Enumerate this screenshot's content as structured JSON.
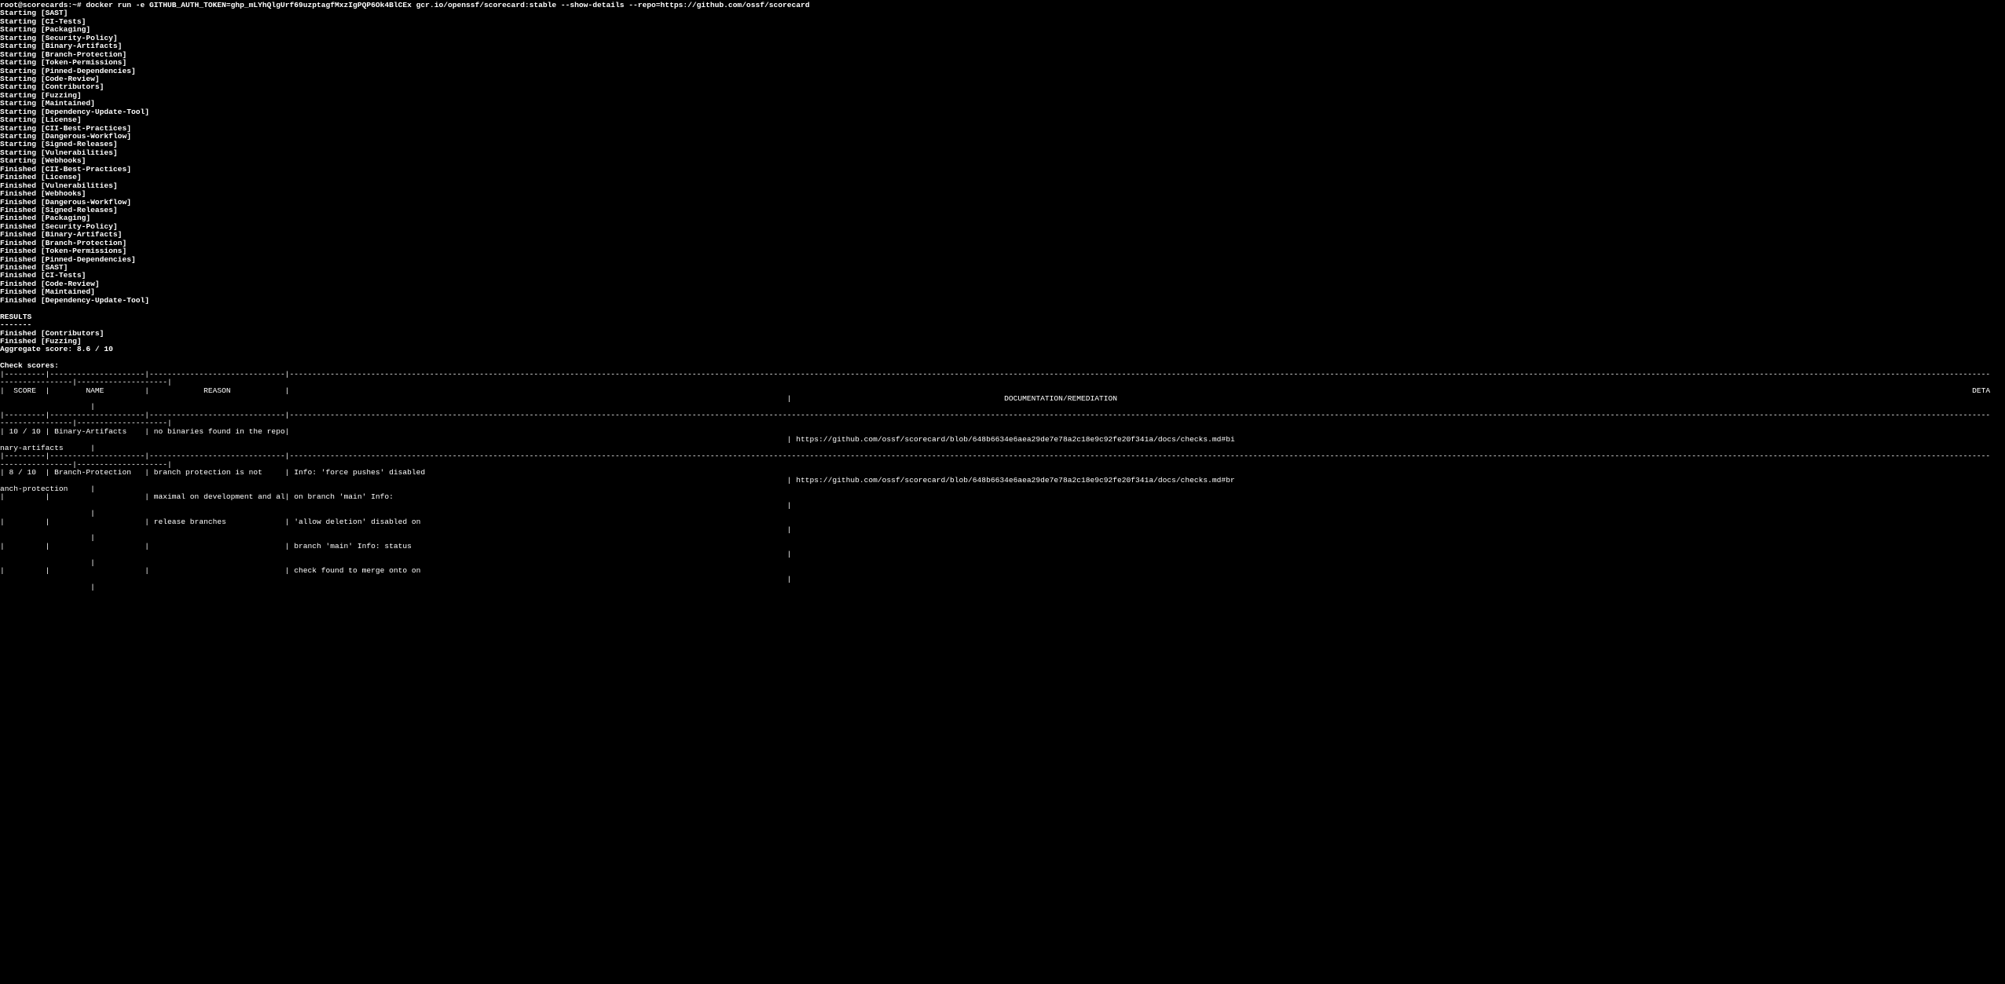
{
  "terminal": {
    "prompt": "root@scorecards:~# ",
    "command": "docker run -e GITHUB_AUTH_TOKEN=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 gcr.io/openssf/scorecard:stable --show-details --repo=https://github.com/ossf/scorecard",
    "progress_lines": [
      "Starting [SAST]",
      "Starting [CI-Tests]",
      "Starting [Packaging]",
      "Starting [Security-Policy]",
      "Starting [Binary-Artifacts]",
      "Starting [Branch-Protection]",
      "Starting [Token-Permissions]",
      "Starting [Pinned-Dependencies]",
      "Starting [Code-Review]",
      "Starting [Contributors]",
      "Starting [Fuzzing]",
      "Starting [Maintained]",
      "Starting [Dependency-Update-Tool]",
      "Starting [License]",
      "Starting [CII-Best-Practices]",
      "Starting [Dangerous-Workflow]",
      "Starting [Signed-Releases]",
      "Starting [Vulnerabilities]",
      "Starting [Webhooks]",
      "Finished [CII-Best-Practices]",
      "Finished [License]",
      "Finished [Vulnerabilities]",
      "Finished [Webhooks]",
      "Finished [Dangerous-Workflow]",
      "Finished [Signed-Releases]",
      "Finished [Packaging]",
      "Finished [Security-Policy]",
      "Finished [Binary-Artifacts]",
      "Finished [Branch-Protection]",
      "Finished [Token-Permissions]",
      "Finished [Pinned-Dependencies]",
      "Finished [SAST]",
      "Finished [CI-Tests]",
      "Finished [Code-Review]",
      "Finished [Maintained]",
      "Finished [Dependency-Update-Tool]"
    ],
    "results_header": "RESULTS",
    "results_underline": "-------",
    "results_lines": [
      "Finished [Contributors]",
      "Finished [Fuzzing]"
    ],
    "aggregate_score": "Aggregate score: 8.6 / 10",
    "check_scores_label": "Check scores:",
    "table": {
      "columns": [
        "SCORE",
        "NAME",
        "REASON",
        "DETAILS",
        "DOCUMENTATION/REMEDIATION"
      ],
      "rows": [
        {
          "score": "10 / 10",
          "name": "Binary-Artifacts",
          "reason": [
            "no binaries found in the repo"
          ],
          "details": [],
          "documentation": "https://github.com/ossf/scorecard/blob/648b6634e6aea29de7e78a2c18e9c92fe20f341a/docs/checks.md#binary-artifacts"
        },
        {
          "score": "8 / 10",
          "name": "Branch-Protection",
          "reason": [
            "branch protection is not",
            "maximal on development and all",
            "release branches"
          ],
          "details": [
            "Info: 'force pushes' disabled",
            "on branch 'main' Info:",
            "'allow deletion' disabled on",
            "branch 'main' Info: status",
            "check found to merge onto on"
          ],
          "documentation": "https://github.com/ossf/scorecard/blob/648b6634e6aea29de7e78a2c18e9c92fe20f341a/docs/checks.md#branch-protection"
        }
      ]
    },
    "colors": {
      "background": "#000000",
      "foreground": "#ffffff"
    }
  }
}
